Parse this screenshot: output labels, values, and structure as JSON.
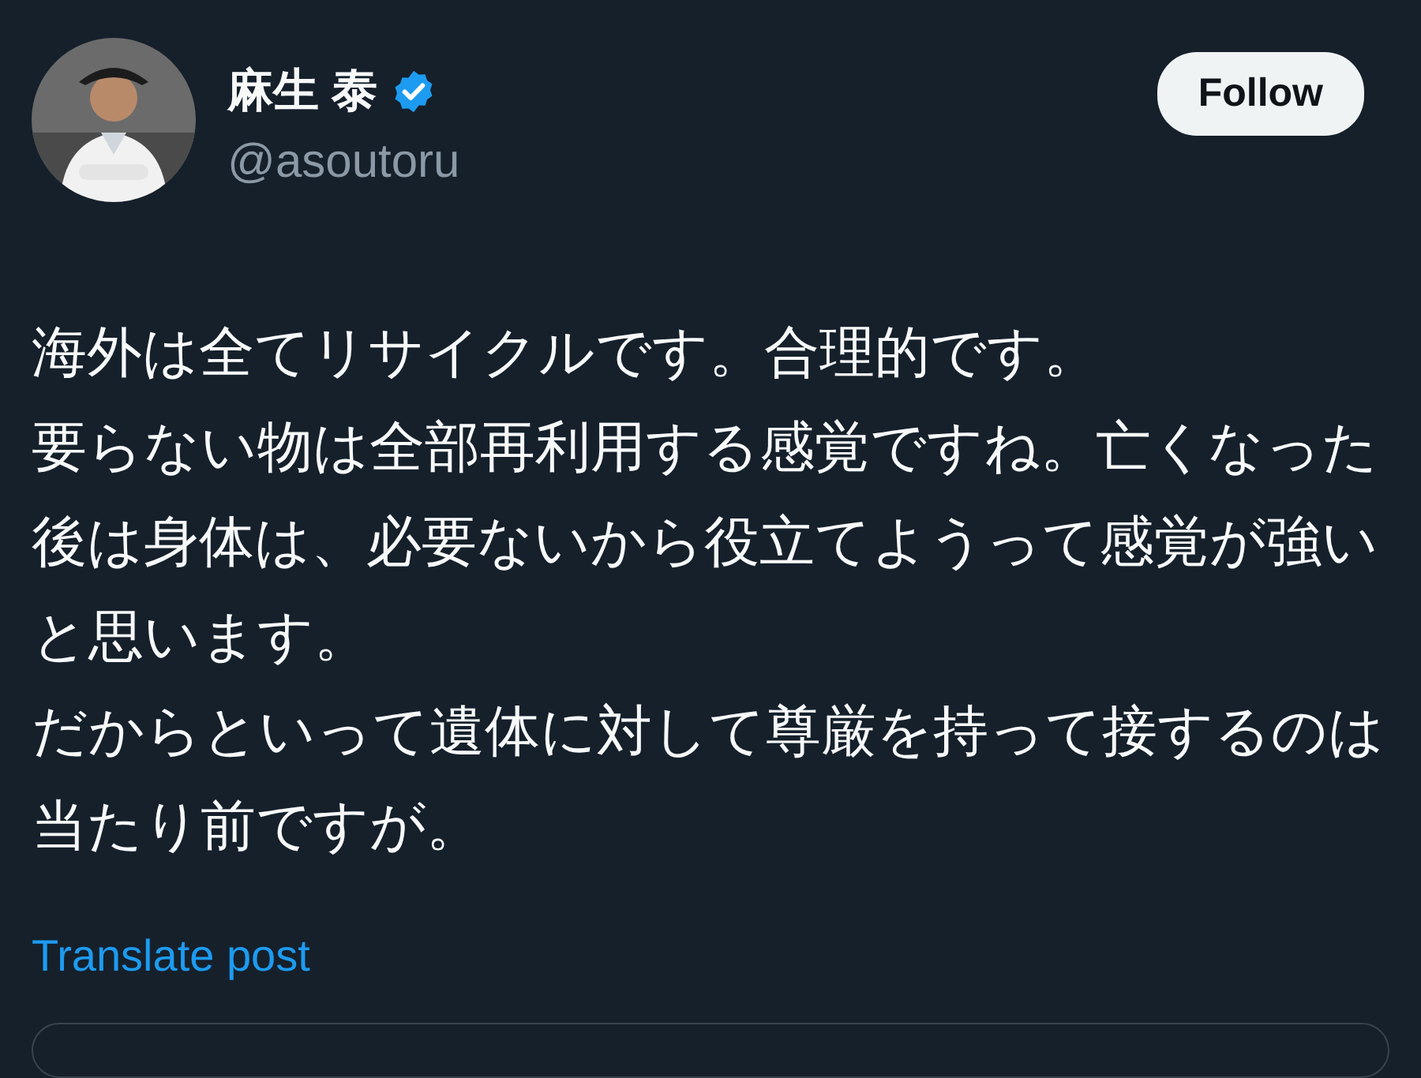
{
  "author": {
    "name": "麻生 泰",
    "verified": true,
    "handle": "@asoutoru"
  },
  "follow_button": {
    "label": "Follow"
  },
  "post": {
    "paragraphs": [
      "海外は全てリサイクルです。合理的です。",
      "要らない物は全部再利用する感覚ですね。亡くなった後は身体は、必要ないから役立てようって感覚が強いと思います。",
      "だからといって遺体に対して尊厳を持って接するのは当たり前ですが。"
    ]
  },
  "translate_link": "Translate post"
}
